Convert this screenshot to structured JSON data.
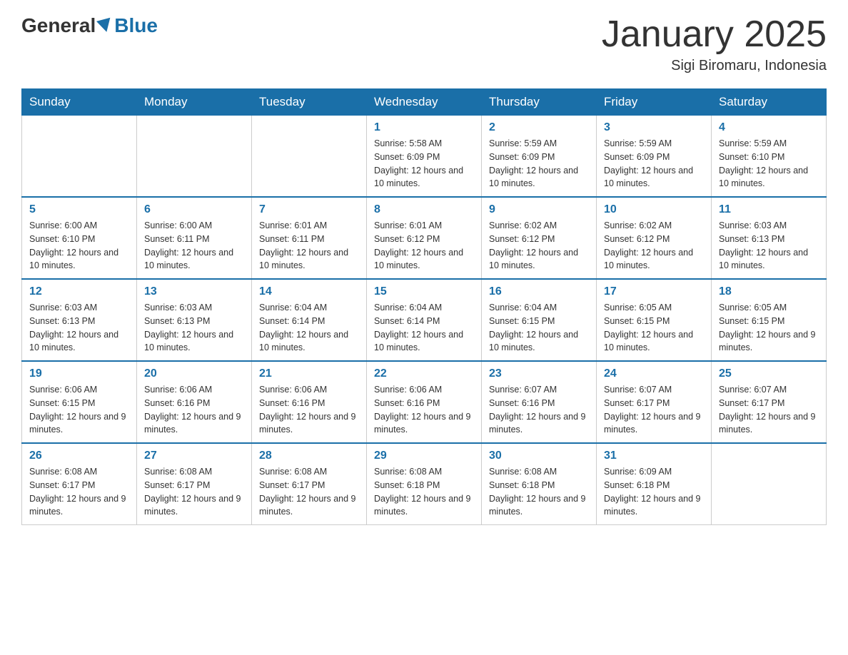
{
  "header": {
    "logo_general": "General",
    "logo_blue": "Blue",
    "month_title": "January 2025",
    "location": "Sigi Biromaru, Indonesia"
  },
  "days_of_week": [
    "Sunday",
    "Monday",
    "Tuesday",
    "Wednesday",
    "Thursday",
    "Friday",
    "Saturday"
  ],
  "weeks": [
    [
      {
        "day": "",
        "sunrise": "",
        "sunset": "",
        "daylight": ""
      },
      {
        "day": "",
        "sunrise": "",
        "sunset": "",
        "daylight": ""
      },
      {
        "day": "",
        "sunrise": "",
        "sunset": "",
        "daylight": ""
      },
      {
        "day": "1",
        "sunrise": "Sunrise: 5:58 AM",
        "sunset": "Sunset: 6:09 PM",
        "daylight": "Daylight: 12 hours and 10 minutes."
      },
      {
        "day": "2",
        "sunrise": "Sunrise: 5:59 AM",
        "sunset": "Sunset: 6:09 PM",
        "daylight": "Daylight: 12 hours and 10 minutes."
      },
      {
        "day": "3",
        "sunrise": "Sunrise: 5:59 AM",
        "sunset": "Sunset: 6:09 PM",
        "daylight": "Daylight: 12 hours and 10 minutes."
      },
      {
        "day": "4",
        "sunrise": "Sunrise: 5:59 AM",
        "sunset": "Sunset: 6:10 PM",
        "daylight": "Daylight: 12 hours and 10 minutes."
      }
    ],
    [
      {
        "day": "5",
        "sunrise": "Sunrise: 6:00 AM",
        "sunset": "Sunset: 6:10 PM",
        "daylight": "Daylight: 12 hours and 10 minutes."
      },
      {
        "day": "6",
        "sunrise": "Sunrise: 6:00 AM",
        "sunset": "Sunset: 6:11 PM",
        "daylight": "Daylight: 12 hours and 10 minutes."
      },
      {
        "day": "7",
        "sunrise": "Sunrise: 6:01 AM",
        "sunset": "Sunset: 6:11 PM",
        "daylight": "Daylight: 12 hours and 10 minutes."
      },
      {
        "day": "8",
        "sunrise": "Sunrise: 6:01 AM",
        "sunset": "Sunset: 6:12 PM",
        "daylight": "Daylight: 12 hours and 10 minutes."
      },
      {
        "day": "9",
        "sunrise": "Sunrise: 6:02 AM",
        "sunset": "Sunset: 6:12 PM",
        "daylight": "Daylight: 12 hours and 10 minutes."
      },
      {
        "day": "10",
        "sunrise": "Sunrise: 6:02 AM",
        "sunset": "Sunset: 6:12 PM",
        "daylight": "Daylight: 12 hours and 10 minutes."
      },
      {
        "day": "11",
        "sunrise": "Sunrise: 6:03 AM",
        "sunset": "Sunset: 6:13 PM",
        "daylight": "Daylight: 12 hours and 10 minutes."
      }
    ],
    [
      {
        "day": "12",
        "sunrise": "Sunrise: 6:03 AM",
        "sunset": "Sunset: 6:13 PM",
        "daylight": "Daylight: 12 hours and 10 minutes."
      },
      {
        "day": "13",
        "sunrise": "Sunrise: 6:03 AM",
        "sunset": "Sunset: 6:13 PM",
        "daylight": "Daylight: 12 hours and 10 minutes."
      },
      {
        "day": "14",
        "sunrise": "Sunrise: 6:04 AM",
        "sunset": "Sunset: 6:14 PM",
        "daylight": "Daylight: 12 hours and 10 minutes."
      },
      {
        "day": "15",
        "sunrise": "Sunrise: 6:04 AM",
        "sunset": "Sunset: 6:14 PM",
        "daylight": "Daylight: 12 hours and 10 minutes."
      },
      {
        "day": "16",
        "sunrise": "Sunrise: 6:04 AM",
        "sunset": "Sunset: 6:15 PM",
        "daylight": "Daylight: 12 hours and 10 minutes."
      },
      {
        "day": "17",
        "sunrise": "Sunrise: 6:05 AM",
        "sunset": "Sunset: 6:15 PM",
        "daylight": "Daylight: 12 hours and 10 minutes."
      },
      {
        "day": "18",
        "sunrise": "Sunrise: 6:05 AM",
        "sunset": "Sunset: 6:15 PM",
        "daylight": "Daylight: 12 hours and 9 minutes."
      }
    ],
    [
      {
        "day": "19",
        "sunrise": "Sunrise: 6:06 AM",
        "sunset": "Sunset: 6:15 PM",
        "daylight": "Daylight: 12 hours and 9 minutes."
      },
      {
        "day": "20",
        "sunrise": "Sunrise: 6:06 AM",
        "sunset": "Sunset: 6:16 PM",
        "daylight": "Daylight: 12 hours and 9 minutes."
      },
      {
        "day": "21",
        "sunrise": "Sunrise: 6:06 AM",
        "sunset": "Sunset: 6:16 PM",
        "daylight": "Daylight: 12 hours and 9 minutes."
      },
      {
        "day": "22",
        "sunrise": "Sunrise: 6:06 AM",
        "sunset": "Sunset: 6:16 PM",
        "daylight": "Daylight: 12 hours and 9 minutes."
      },
      {
        "day": "23",
        "sunrise": "Sunrise: 6:07 AM",
        "sunset": "Sunset: 6:16 PM",
        "daylight": "Daylight: 12 hours and 9 minutes."
      },
      {
        "day": "24",
        "sunrise": "Sunrise: 6:07 AM",
        "sunset": "Sunset: 6:17 PM",
        "daylight": "Daylight: 12 hours and 9 minutes."
      },
      {
        "day": "25",
        "sunrise": "Sunrise: 6:07 AM",
        "sunset": "Sunset: 6:17 PM",
        "daylight": "Daylight: 12 hours and 9 minutes."
      }
    ],
    [
      {
        "day": "26",
        "sunrise": "Sunrise: 6:08 AM",
        "sunset": "Sunset: 6:17 PM",
        "daylight": "Daylight: 12 hours and 9 minutes."
      },
      {
        "day": "27",
        "sunrise": "Sunrise: 6:08 AM",
        "sunset": "Sunset: 6:17 PM",
        "daylight": "Daylight: 12 hours and 9 minutes."
      },
      {
        "day": "28",
        "sunrise": "Sunrise: 6:08 AM",
        "sunset": "Sunset: 6:17 PM",
        "daylight": "Daylight: 12 hours and 9 minutes."
      },
      {
        "day": "29",
        "sunrise": "Sunrise: 6:08 AM",
        "sunset": "Sunset: 6:18 PM",
        "daylight": "Daylight: 12 hours and 9 minutes."
      },
      {
        "day": "30",
        "sunrise": "Sunrise: 6:08 AM",
        "sunset": "Sunset: 6:18 PM",
        "daylight": "Daylight: 12 hours and 9 minutes."
      },
      {
        "day": "31",
        "sunrise": "Sunrise: 6:09 AM",
        "sunset": "Sunset: 6:18 PM",
        "daylight": "Daylight: 12 hours and 9 minutes."
      },
      {
        "day": "",
        "sunrise": "",
        "sunset": "",
        "daylight": ""
      }
    ]
  ]
}
